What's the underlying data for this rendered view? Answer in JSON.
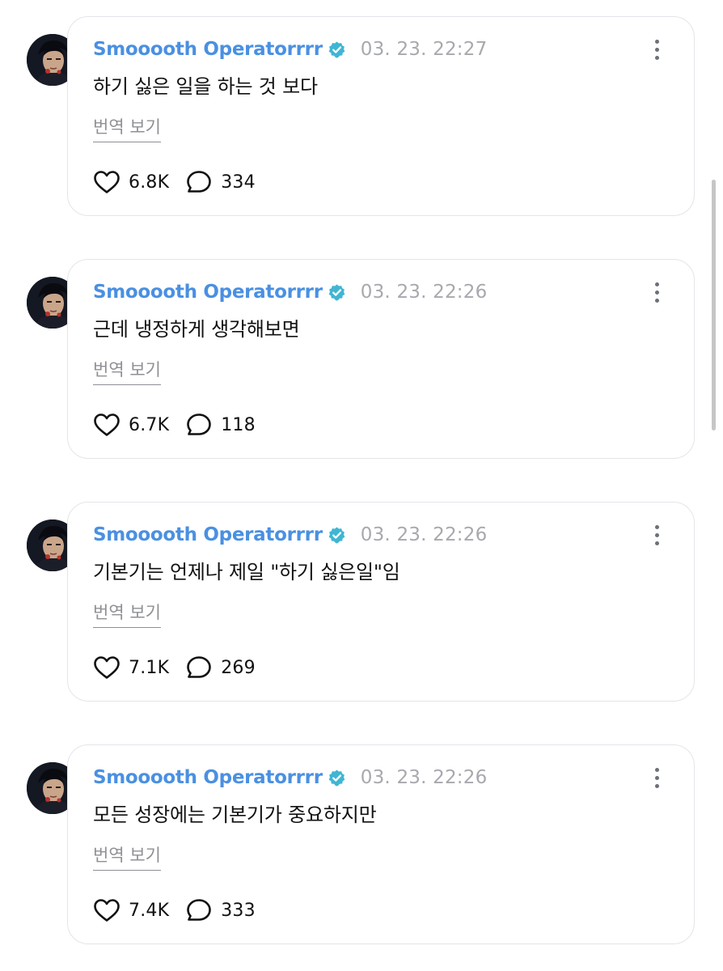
{
  "colors": {
    "name": "#4a90e2",
    "verified_badge": "#3fb6d3",
    "timestamp": "#a7a9ae",
    "card_border": "#e3e5ea"
  },
  "icons": {
    "verified": "verified-badge-icon",
    "like": "heart-icon",
    "reply": "speech-bubble-icon",
    "more": "more-vertical-icon"
  },
  "posts": [
    {
      "author": "Smooooth Operatorrrr",
      "timestamp": "03. 23. 22:27",
      "text": "하기 싫은 일을 하는 것 보다",
      "translate_label": "번역 보기",
      "likes": "6.8K",
      "replies": "334"
    },
    {
      "author": "Smooooth Operatorrrr",
      "timestamp": "03. 23. 22:26",
      "text": "근데 냉정하게 생각해보면",
      "translate_label": "번역 보기",
      "likes": "6.7K",
      "replies": "118"
    },
    {
      "author": "Smooooth Operatorrrr",
      "timestamp": "03. 23. 22:26",
      "text": "기본기는 언제나 제일 \"하기 싫은일\"임",
      "translate_label": "번역 보기",
      "likes": "7.1K",
      "replies": "269"
    },
    {
      "author": "Smooooth Operatorrrr",
      "timestamp": "03. 23. 22:26",
      "text": "모든 성장에는 기본기가 중요하지만",
      "translate_label": "번역 보기",
      "likes": "7.4K",
      "replies": "333"
    }
  ]
}
